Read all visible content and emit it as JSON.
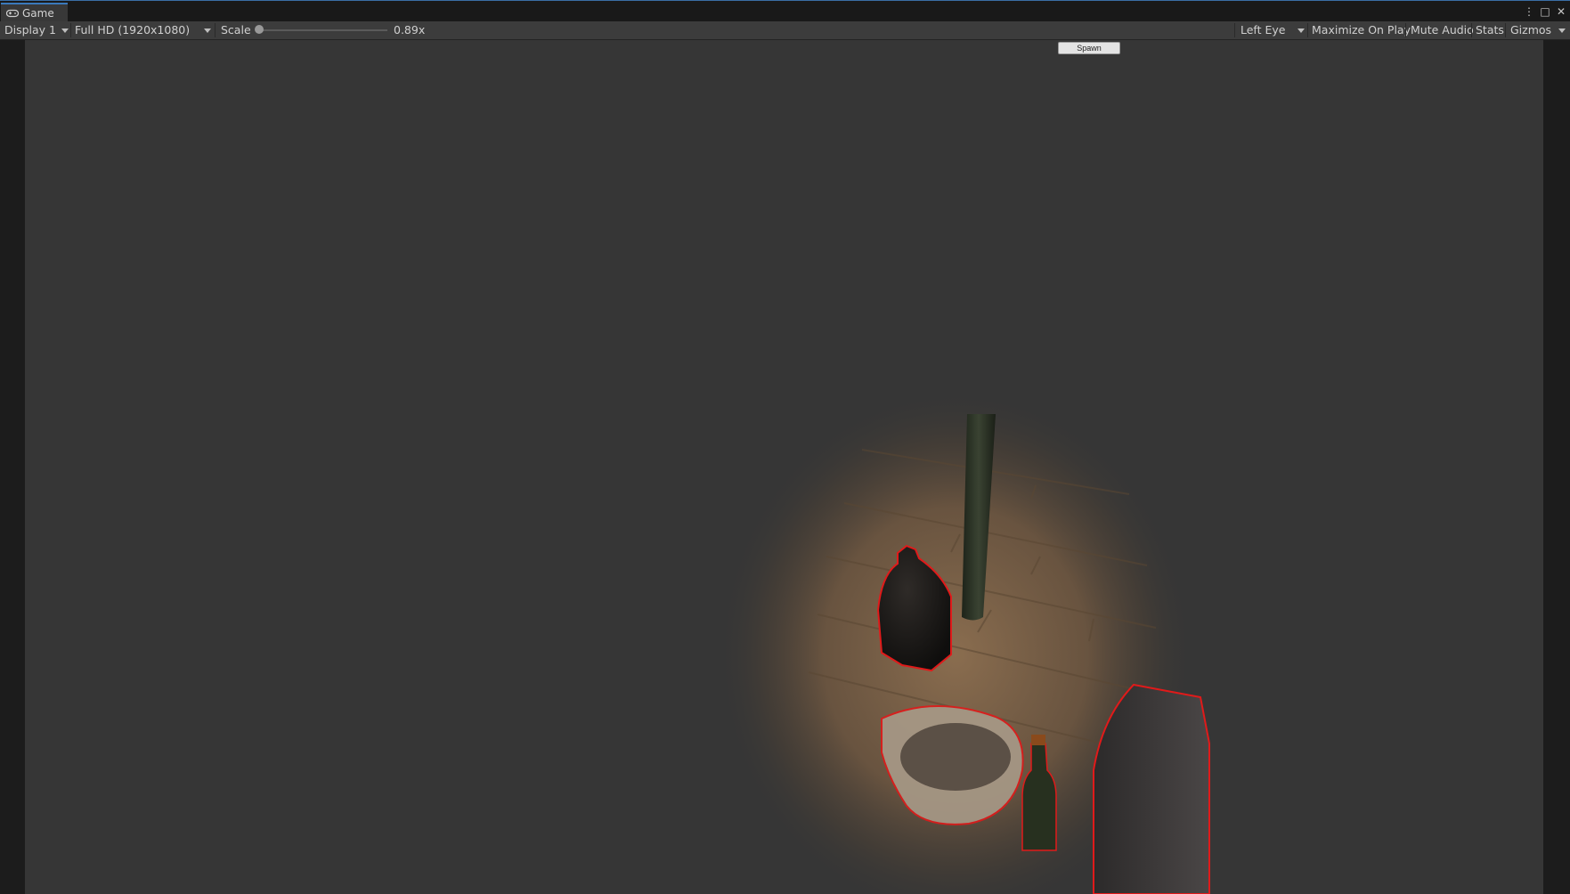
{
  "window": {
    "tab_title": "Game",
    "controls": {
      "more": "⋮",
      "maximize": "□",
      "close": "✕"
    }
  },
  "toolbar": {
    "display": "Display 1",
    "resolution": "Full HD (1920x1080)",
    "scale_label": "Scale",
    "scale_value": "0.89x",
    "scale_fraction": 0.0,
    "eye": "Left Eye",
    "maximize_on_play": "Maximize On Play",
    "mute_audio": "Mute Audio",
    "stats": "Stats",
    "gizmos": "Gizmos"
  },
  "game": {
    "spawn_label": "Spawn"
  },
  "colors": {
    "toolbar_bg": "#3c3c3c",
    "viewport_bg": "#363636",
    "highlight_outline": "#e01a1a",
    "floor_wood": "#7a6246"
  }
}
